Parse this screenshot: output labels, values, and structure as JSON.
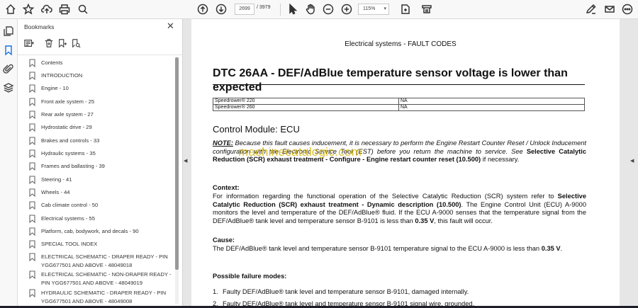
{
  "toolbar": {
    "page_current": "2699",
    "page_total": "/ 3979",
    "zoom": "115%",
    "icons": [
      "home-icon",
      "bookmark-star-icon",
      "upload-icon",
      "print-icon",
      "zoom-search-icon",
      "page-up-icon",
      "page-down-icon",
      "select-cursor-icon",
      "hand-tool-icon",
      "zoom-out-icon",
      "zoom-in-icon",
      "page-fit-icon",
      "scroll-mode-icon",
      "sign-pen-icon",
      "mail-icon",
      "more-icon"
    ]
  },
  "panel": {
    "title": "Bookmarks",
    "close": "✕",
    "items": [
      {
        "label": "Contents"
      },
      {
        "label": "INTRODUCTION"
      },
      {
        "label": "Engine - 10"
      },
      {
        "label": "Front axle system - 25"
      },
      {
        "label": "Rear axle system - 27"
      },
      {
        "label": "Hydrostatic drive - 29"
      },
      {
        "label": "Brakes and controls - 33"
      },
      {
        "label": "Hydraulic systems - 35"
      },
      {
        "label": "Frames and ballasting - 39"
      },
      {
        "label": "Steering - 41"
      },
      {
        "label": "Wheels - 44"
      },
      {
        "label": "Cab climate control - 50"
      },
      {
        "label": "Electrical systems - 55"
      },
      {
        "label": "Platform, cab, bodywork, and decals - 90"
      },
      {
        "label": "SPECIAL TOOL INDEX"
      },
      {
        "label": "ELECTRICAL SCHEMATIC - DRAPER READY - PIN YGG677501 AND ABOVE - 48049018"
      },
      {
        "label": "ELECTRICAL SCHEMATIC - NON-DRAPER READY - PIN YGG677501 AND ABOVE - 48049019"
      },
      {
        "label": "HYDRAULIC SCHEMATIC - DRAPER READY - PIN YGG677501 AND ABOVE - 48049008"
      }
    ]
  },
  "document": {
    "header": "Electrical systems - FAULT CODES",
    "title": "DTC 26AA - DEF/AdBlue temperature sensor voltage is lower than expected",
    "models": [
      {
        "model": "Speedrower® 220",
        "value": "NA"
      },
      {
        "model": "Speedrower® 260",
        "value": "NA"
      }
    ],
    "control_module": "Control Module:  ECU",
    "note_label": "NOTE:",
    "note_text": " Because this fault causes inducement, it is necessary to perform the Engine Restart Counter Reset / Unlock Inducement configuration with the Electronic Service Tool (EST) before you return the machine to service.  See ",
    "note_bold": "Selective Catalytic Reduction (SCR) exhaust treatment - Configure - Engine restart counter reset (10.500)",
    "note_tail": " if necessary.",
    "watermark": "machinecatalogic.com",
    "context_label": "Context:",
    "context_pre": "For information regarding the functional operation of the Selective Catalytic Reduction (SCR) system refer to ",
    "context_bold": "Selective Catalytic Reduction (SCR) exhaust treatment - Dynamic description (10.500)",
    "context_post": ".  The Engine Control Unit (ECU) A-9000 monitors the level and temperature of the DEF/AdBlue® fluid.  If the ECU A-9000 senses that the temperature signal from the DEF/AdBlue® tank level and temperature sensor B-9101 is less than ",
    "context_value": "0.35 V",
    "context_end": ", this fault will occur.",
    "cause_label": "Cause:",
    "cause_pre": "The DEF/AdBlue® tank level and temperature sensor B-9101 temperature signal to the ECU A-9000 is less than ",
    "cause_value": "0.35 V",
    "cause_end": ".",
    "failure_label": "Possible failure modes:",
    "failure_modes": [
      {
        "num": "1.",
        "text": "Faulty DEF/AdBlue® tank level and temperature sensor B-9101, damaged internally."
      },
      {
        "num": "2.",
        "text": "Faulty DEF/AdBlue® tank level and temperature sensor B-9101 signal wire, grounded."
      }
    ]
  }
}
